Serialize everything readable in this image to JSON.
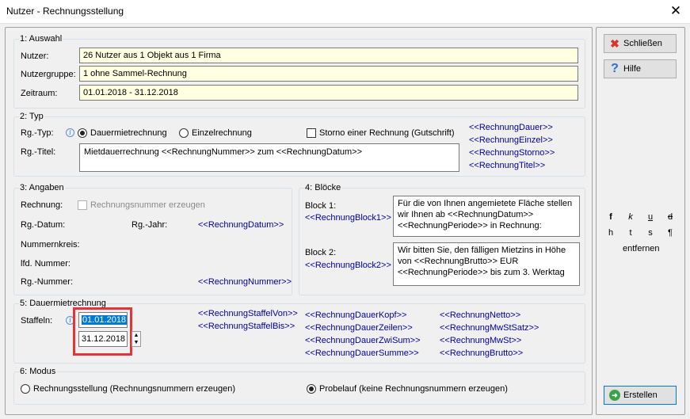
{
  "window": {
    "title": "Nutzer - Rechnungsstellung",
    "close_glyph": "✕"
  },
  "auswahl": {
    "group_label": "1: Auswahl",
    "nutzer_label": "Nutzer:",
    "nutzer_value": "26 Nutzer aus 1 Objekt aus 1 Firma",
    "gruppe_label": "Nutzergruppe:",
    "gruppe_value": "1 ohne Sammel-Rechnung",
    "zeitraum_label": "Zeitraum:",
    "zeitraum_value": "01.01.2018 - 31.12.2018"
  },
  "typ": {
    "group_label": "2: Typ",
    "rgtyp_label": "Rg.-Typ:",
    "radio_dauer": "Dauermietrechnung",
    "radio_einzel": "Einzelrechnung",
    "storno_label": "Storno einer Rechnung (Gutschrift)",
    "rgtitel_label": "Rg.-Titel:",
    "rgtitel_value": "Mietdauerrechnung <<RechnungNummer>> zum <<RechnungDatum>>",
    "tags": [
      "<<RechnungDauer>>",
      "<<RechnungEinzel>>",
      "<<RechnungStorno>>",
      "<<RechnungTitel>>"
    ]
  },
  "angaben": {
    "group_label": "3: Angaben",
    "rechnung_label": "Rechnung:",
    "erzeugen_label": "Rechnungsnummer erzeugen",
    "datum_label": "Rg.-Datum:",
    "jahr_label": "Rg.-Jahr:",
    "datum_tag": "<<RechnungDatum>>",
    "kreis_label": "Nummernkreis:",
    "lfd_label": "lfd. Nummer:",
    "nummer_label": "Rg.-Nummer:",
    "nummer_tag": "<<RechnungNummer>>"
  },
  "bloecke": {
    "group_label": "4: Blöcke",
    "block1_label": "Block 1:",
    "block1_tag": "<<RechnungBlock1>>",
    "block1_lines": [
      "Für die von Ihnen angemietete Fläche stellen",
      "wir Ihnen ab <<RechnungDatum>>",
      "<<RechnungPeriode>> in Rechnung:"
    ],
    "block2_label": "Block 2:",
    "block2_tag": "<<RechnungBlock2>>",
    "block2_lines": [
      "Wir bitten Sie, den fälligen Mietzins in Höhe",
      "von <<RechnungBrutto>> EUR",
      "<<RechnungPeriode>> bis zum 3. Werktag"
    ]
  },
  "dauermiet": {
    "group_label": "5: Dauermietrechnung",
    "staffeln_label": "Staffeln:",
    "date1": "01.01.2018",
    "date2": "31.12.2018",
    "tags_col1": [
      "<<RechnungStaffelVon>>",
      "<<RechnungStaffelBis>>"
    ],
    "tags_col2": [
      "<<RechnungDauerKopf>>",
      "<<RechnungDauerZeilen>>",
      "<<RechnungDauerZwiSum>>",
      "<<RechnungDauerSumme>>"
    ],
    "tags_col3": [
      "<<RechnungNetto>>",
      "<<RechnungMwStSatz>>",
      "<<RechnungMwSt>>",
      "<<RechnungBrutto>>"
    ]
  },
  "modus": {
    "group_label": "6: Modus",
    "radio_stellung": "Rechnungsstellung (Rechnungsnummern erzeugen)",
    "radio_probe": "Probelauf (keine Rechnungsnummern erzeugen)"
  },
  "side": {
    "close_button": "Schließen",
    "help_button": "Hilfe",
    "format_row1": [
      "f",
      "k",
      "u",
      "d"
    ],
    "format_row2": [
      "h",
      "t",
      "s",
      "¶"
    ],
    "remove_label": "entfernen",
    "create_button": "Erstellen"
  }
}
